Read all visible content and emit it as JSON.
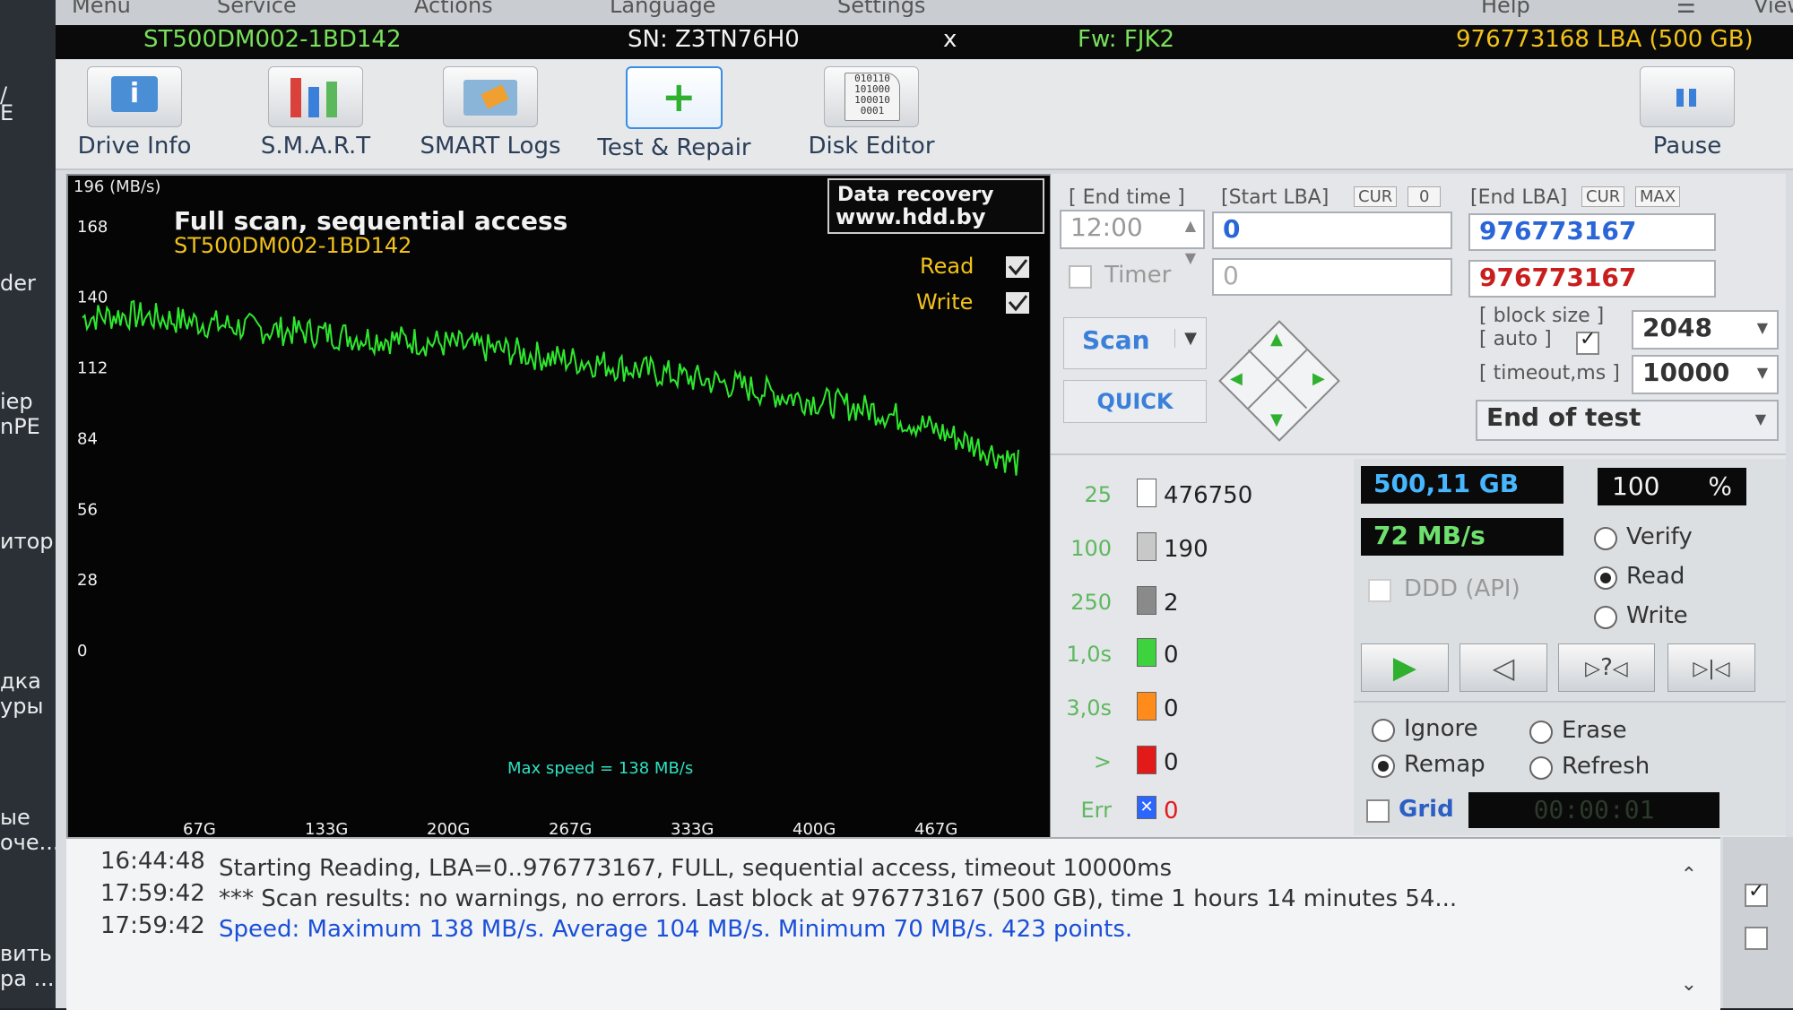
{
  "desktop": {
    "fragments": [
      "/",
      "E",
      "der",
      "iep",
      "nPE",
      "итор",
      "дка",
      "уры",
      "ые",
      "оче...",
      "вить",
      "ра ..."
    ]
  },
  "menu": [
    "Menu",
    "Service",
    "Actions",
    "Language",
    "Settings",
    "Help",
    "View"
  ],
  "drive_info": {
    "model": "ST500DM002-1BD142",
    "serial": "SN: Z3TN76H0",
    "close": "x",
    "firmware": "Fw: FJK2",
    "capacity": "976773168 LBA (500 GB)"
  },
  "toolbar": {
    "drive_info": "Drive Info",
    "smart": "S.M.A.R.T",
    "smart_logs": "SMART Logs",
    "test_repair": "Test & Repair",
    "disk_editor": "Disk Editor",
    "pause": "Pause"
  },
  "graph": {
    "unit": "196 (MB/s)",
    "title": "Full scan, sequential access",
    "subtitle": "ST500DM002-1BD142",
    "watermark1": "Data recovery",
    "watermark2": "www.hdd.by",
    "read_label": "Read",
    "write_label": "Write",
    "max_speed": "Max speed = 138 MB/s",
    "line_color": "#2ee82e"
  },
  "chart_data": {
    "type": "line",
    "title": "Full scan, sequential access",
    "subtitle": "ST500DM002-1BD142",
    "ylabel": "196 (MB/s)",
    "ylim": [
      0,
      196
    ],
    "y_ticks": [
      "168",
      "140",
      "112",
      "84",
      "56",
      "28",
      "0"
    ],
    "x_ticks": [
      "67G",
      "133G",
      "200G",
      "267G",
      "333G",
      "400G",
      "467G"
    ],
    "xlim": [
      0,
      500
    ],
    "series": [
      {
        "name": "Read",
        "x": [
          0,
          25,
          50,
          75,
          100,
          125,
          150,
          175,
          200,
          225,
          250,
          275,
          300,
          325,
          350,
          375,
          400,
          425,
          450,
          475,
          500
        ],
        "values": [
          132,
          133,
          131,
          129,
          127,
          126,
          124,
          123,
          121,
          119,
          116,
          114,
          111,
          108,
          105,
          101,
          98,
          95,
          89,
          82,
          74
        ]
      }
    ],
    "annotation": "Max speed = 138 MB/s",
    "grid": false
  },
  "controls": {
    "end_time_label": "[ End time ]",
    "end_time_value": "12:00",
    "timer_label": "Timer",
    "start_lba_label": "[Start LBA]",
    "cur": "CUR",
    "zero": "0",
    "start_lba": "0",
    "timer_value": "0",
    "end_lba_label": "[End LBA]",
    "max": "MAX",
    "end_lba": "976773167",
    "end_lba2": "976773167",
    "scan": "Scan",
    "quick": "QUICK",
    "block_size_label": "[ block size ]",
    "auto_label": "[ auto ]",
    "block_size": "2048",
    "timeout_label": "[ timeout,ms ]",
    "timeout": "10000",
    "end_action": "End of test"
  },
  "counters": [
    {
      "threshold": "25",
      "value": "476750",
      "color": "#ffffff"
    },
    {
      "threshold": "100",
      "value": "190",
      "color": "#c8c8c8"
    },
    {
      "threshold": "250",
      "value": "2",
      "color": "#8a8a8a"
    },
    {
      "threshold": "1,0s",
      "value": "0",
      "color": "#3fd23f"
    },
    {
      "threshold": "3,0s",
      "value": "0",
      "color": "#ff8c1a"
    },
    {
      "threshold": ">",
      "value": "0",
      "color": "#e21a1a"
    },
    {
      "threshold": "Err",
      "value": "0",
      "color": "#2b66ff"
    }
  ],
  "stats": {
    "size": "500,11 GB",
    "percent": "100",
    "percent_sign": "%",
    "speed": "72 MB/s",
    "ddd": "DDD (API)"
  },
  "mode": {
    "verify": "Verify",
    "read": "Read",
    "write": "Write",
    "selected": "Read"
  },
  "playback": {
    "next_label": "?"
  },
  "actions": {
    "ignore": "Ignore",
    "erase": "Erase",
    "remap": "Remap",
    "refresh": "Refresh",
    "selected": "Remap"
  },
  "grid_label": "Grid",
  "elapsed": "00:00:01",
  "log": [
    {
      "time": "16:44:48",
      "msg": "Starting Reading, LBA=0..976773167, FULL, sequential access, timeout 10000ms",
      "color": "#333333"
    },
    {
      "time": "17:59:42",
      "msg": "*** Scan results: no warnings, no errors. Last block at 976773167 (500 GB), time 1 hours 14 minutes 54...",
      "color": "#333333"
    },
    {
      "time": "17:59:42",
      "msg": "Speed: Maximum 138 MB/s. Average 104 MB/s. Minimum 70 MB/s. 423 points.",
      "color": "#1a4fd8"
    }
  ]
}
